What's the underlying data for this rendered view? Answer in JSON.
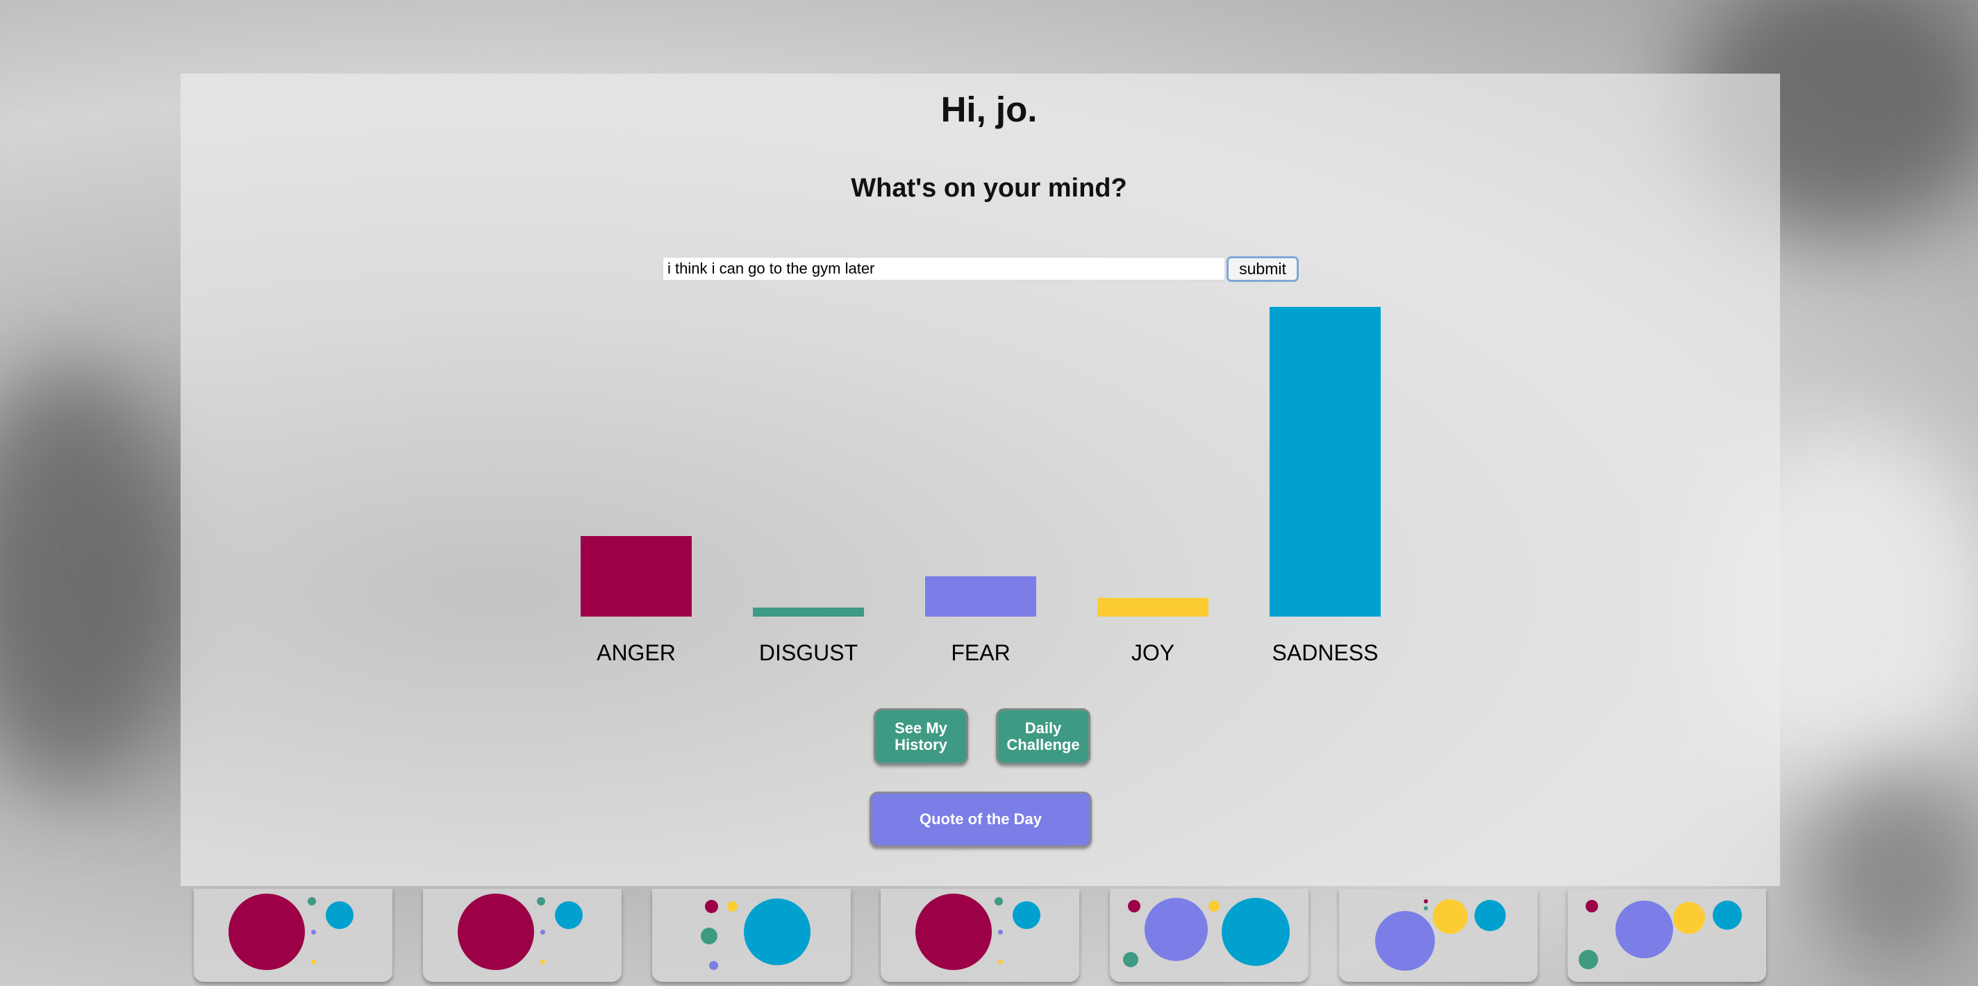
{
  "greeting": "Hi, jo.",
  "prompt": "What's on your mind?",
  "entry": {
    "value": "i think i can go to the gym later",
    "submit_label": "submit"
  },
  "colors": {
    "anger": "#9c0047",
    "disgust": "#3e9a82",
    "fear": "#7b7ee6",
    "joy": "#fdcc32",
    "sadness": "#00a1cf",
    "button_green": "#3f9a84",
    "button_purple": "#7b7ee6"
  },
  "chart_data": {
    "type": "bar",
    "categories": [
      "ANGER",
      "DISGUST",
      "FEAR",
      "JOY",
      "SADNESS"
    ],
    "values": [
      0.26,
      0.03,
      0.13,
      0.06,
      1.0
    ],
    "title": "",
    "xlabel": "",
    "ylabel": "",
    "ylim": [
      0,
      1
    ]
  },
  "buttons": {
    "history": "See My History",
    "challenge": "Daily Challenge",
    "quote": "Quote of the Day"
  },
  "history_cards": [
    {
      "anger": 1.0,
      "disgust": 0.2,
      "fear": 0.15,
      "joy": 0.15,
      "sadness": 0.5
    },
    {
      "anger": 1.0,
      "disgust": 0.2,
      "fear": 0.15,
      "joy": 0.15,
      "sadness": 0.5
    },
    {
      "anger": 0.3,
      "disgust": 0.35,
      "fear": 0.25,
      "joy": 0.25,
      "sadness": 1.0
    },
    {
      "anger": 1.0,
      "disgust": 0.2,
      "fear": 0.15,
      "joy": 0.15,
      "sadness": 0.5
    },
    {
      "anger": 0.3,
      "disgust": 0.35,
      "fear": 0.9,
      "joy": 0.3,
      "sadness": 1.0
    },
    {
      "anger": 0.05,
      "disgust": 0.05,
      "fear": 1.0,
      "joy": 0.7,
      "sadness": 0.65
    },
    {
      "anger": 0.3,
      "disgust": 0.45,
      "fear": 0.9,
      "joy": 0.6,
      "sadness": 0.55
    }
  ]
}
